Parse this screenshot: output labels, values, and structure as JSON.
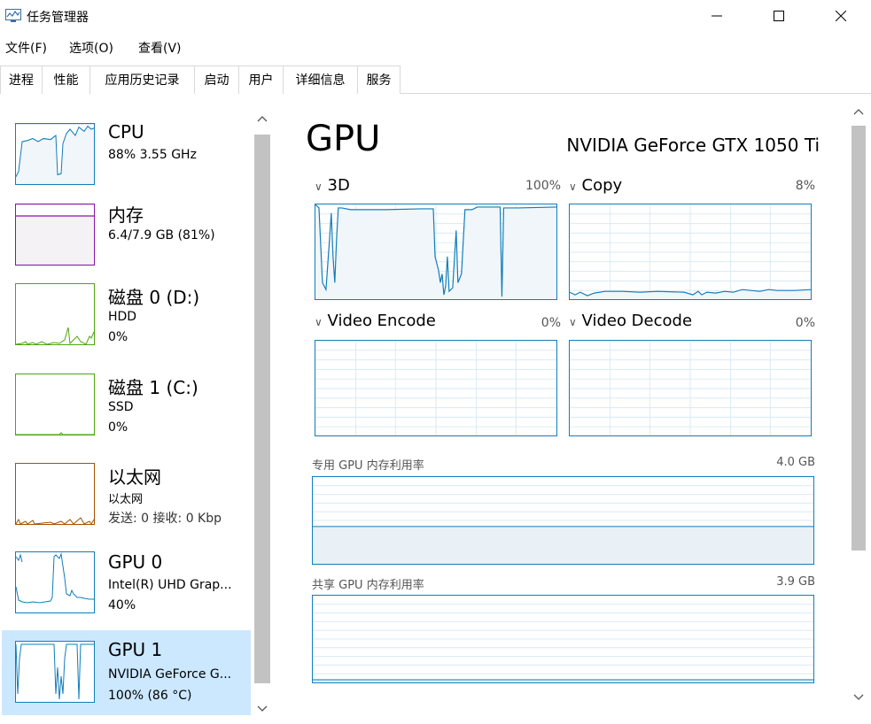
{
  "window": {
    "title": "任务管理器"
  },
  "menu": {
    "file": "文件(F)",
    "options": "选项(O)",
    "view": "查看(V)"
  },
  "tabs": [
    {
      "label": "进程"
    },
    {
      "label": "性能"
    },
    {
      "label": "应用历史记录"
    },
    {
      "label": "启动"
    },
    {
      "label": "用户"
    },
    {
      "label": "详细信息"
    },
    {
      "label": "服务"
    }
  ],
  "sidebar": {
    "items": [
      {
        "name": "CPU",
        "line1": "88%  3.55 GHz",
        "line2": "",
        "color": "#117dbb"
      },
      {
        "name": "内存",
        "line1": "6.4/7.9 GB (81%)",
        "line2": "",
        "color": "#8b12ae"
      },
      {
        "name": "磁盘 0 (D:)",
        "line1": "HDD",
        "line2": "0%",
        "color": "#4da60c"
      },
      {
        "name": "磁盘 1 (C:)",
        "line1": "SSD",
        "line2": "0%",
        "color": "#4da60c"
      },
      {
        "name": "以太网",
        "line1": "以太网",
        "line2": "发送: 0  接收: 0 Kbp",
        "color": "#a74f01"
      },
      {
        "name": "GPU 0",
        "line1": "Intel(R) UHD Grap...",
        "line2": "40%",
        "color": "#117dbb"
      },
      {
        "name": "GPU 1",
        "line1": "NVIDIA GeForce G...",
        "line2": "100%  (86 °C)",
        "color": "#117dbb"
      }
    ]
  },
  "main": {
    "title": "GPU",
    "model": "NVIDIA GeForce GTX 1050 Ti",
    "engines": [
      {
        "label": "3D",
        "percent": "100%"
      },
      {
        "label": "Copy",
        "percent": "8%"
      },
      {
        "label": "Video Encode",
        "percent": "0%"
      },
      {
        "label": "Video Decode",
        "percent": "0%"
      }
    ],
    "dedicated": {
      "label": "专用 GPU 内存利用率",
      "max": "4.0 GB"
    },
    "shared": {
      "label": "共享 GPU 内存利用率",
      "max": "3.9 GB"
    }
  },
  "colors": {
    "accent": "#117dbb",
    "selected": "#cce8ff"
  }
}
